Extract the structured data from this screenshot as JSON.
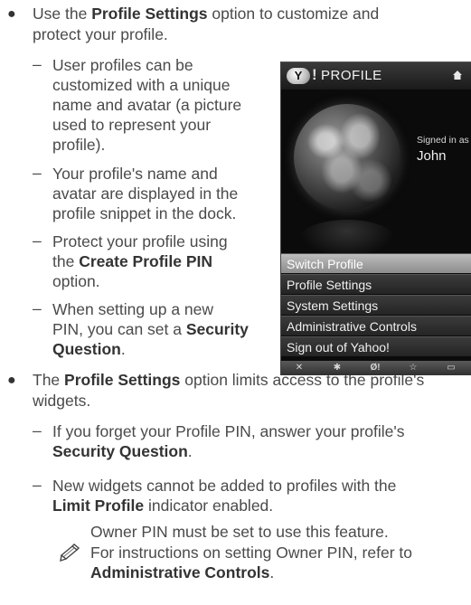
{
  "bullets": [
    {
      "line1": {
        "pre": "Use the ",
        "bold": "Profile Settings",
        "post": " option to customize and"
      },
      "line2": "protect your profile."
    },
    {
      "line1": {
        "pre": "The ",
        "bold": "Profile Settings",
        "post": " option limits access to the profile's"
      },
      "line2": "widgets."
    }
  ],
  "sub1": [
    {
      "lines": [
        "User profiles can be",
        "customized with a unique",
        "name and avatar (a picture",
        "used to represent your",
        "profile)."
      ]
    },
    {
      "lines": [
        "Your profile's name and",
        "avatar are displayed in the",
        "profile snippet in the dock."
      ]
    },
    {
      "l1": "Protect your profile using",
      "l2_pre": "the ",
      "l2_bold": "Create Profile PIN",
      "l3": "option."
    },
    {
      "l1": "When setting up a new",
      "l2_pre": "PIN, you can set a ",
      "l2_bold": "Security",
      "l3_bold": "Question",
      "l3_post": "."
    }
  ],
  "sub2": [
    {
      "l1": "If you forget your Profile PIN, answer your profile's",
      "l2_bold": "Security Question",
      "l2_post": "."
    },
    {
      "l1": "New widgets cannot be added to profiles with the",
      "l2_bold": "Limit Profile",
      "l2_post": " indicator enabled."
    }
  ],
  "note": {
    "l1": "Owner PIN must be set to use this feature.",
    "l2": "For instructions on setting Owner PIN, refer to",
    "l3_bold": "Administrative Controls",
    "l3_post": "."
  },
  "tv": {
    "logo": "Y",
    "header_title": "PROFILE",
    "signed_in_label": "Signed in as",
    "user_name": "John",
    "menu": [
      "Switch Profile",
      "Profile Settings",
      "System Settings",
      "Administrative Controls",
      "Sign out of Yahoo!"
    ],
    "dock_icons": [
      "close-icon",
      "gear-icon",
      "yahoo-icon",
      "star-icon",
      "widget-icon"
    ]
  }
}
